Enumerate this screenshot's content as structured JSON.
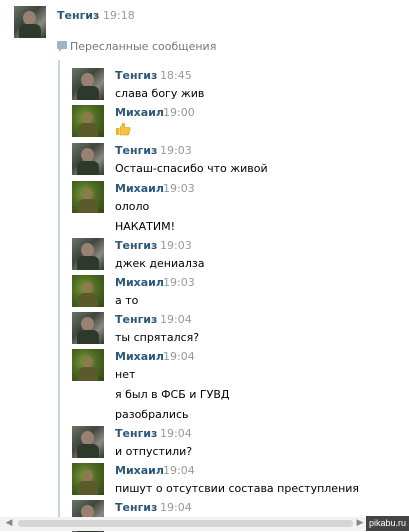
{
  "top": {
    "name": "Тенгиз",
    "time": "19:18"
  },
  "forwarded_label": "Пересланные сообщения",
  "messages": [
    {
      "name": "Тенгиз",
      "time": "18:45",
      "lines": [
        "слава богу жив"
      ]
    },
    {
      "name": "Михаил",
      "time": "19:00",
      "lines": [
        "thumbs-up-emoji"
      ]
    },
    {
      "name": "Тенгиз",
      "time": "19:03",
      "lines": [
        "Осташ-спасибо что живой"
      ]
    },
    {
      "name": "Михаил",
      "time": "19:03",
      "lines": [
        "ололо",
        "НАКАТИМ!"
      ]
    },
    {
      "name": "Тенгиз",
      "time": "19:03",
      "lines": [
        "джек дениалза"
      ]
    },
    {
      "name": "Михаил",
      "time": "19:03",
      "lines": [
        "а то"
      ]
    },
    {
      "name": "Тенгиз",
      "time": "19:04",
      "lines": [
        "ты спрятался?"
      ]
    },
    {
      "name": "Михаил",
      "time": "19:04",
      "lines": [
        "нет",
        "я был в ФСБ и ГУВД",
        "разобрались"
      ]
    },
    {
      "name": "Тенгиз",
      "time": "19:04",
      "lines": [
        "и отпустили?"
      ]
    },
    {
      "name": "Михаил",
      "time": "19:04",
      "lines": [
        "пишут о отсутсвии состава преступления"
      ]
    },
    {
      "name": "Тенгиз",
      "time": "19:04",
      "lines": []
    }
  ],
  "watermark": "pikabu.ru",
  "colors": {
    "name": "#2b587a",
    "time": "#999999",
    "thread_line": "#c8d5e3"
  }
}
